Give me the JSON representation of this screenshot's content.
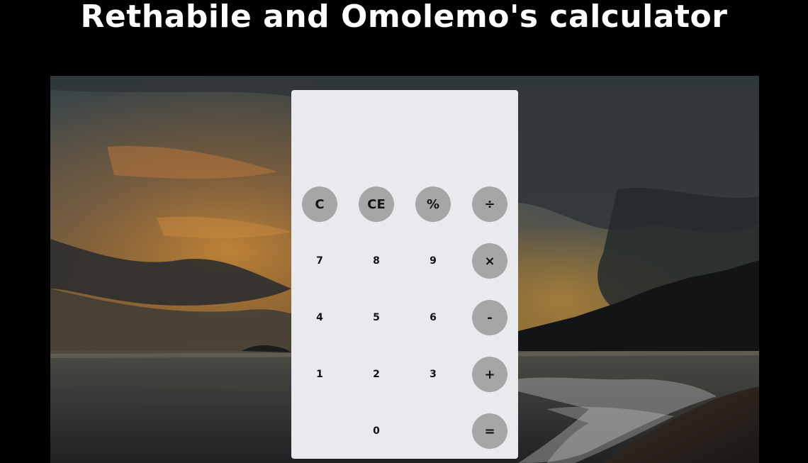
{
  "title": "Rethabile and Omolemo's calculator",
  "display": {
    "value": ""
  },
  "keys": {
    "clear": "C",
    "clear_entry": "CE",
    "percent": "%",
    "divide": "÷",
    "seven": "7",
    "eight": "8",
    "nine": "9",
    "multiply": "×",
    "four": "4",
    "five": "5",
    "six": "6",
    "minus": "-",
    "one": "1",
    "two": "2",
    "three": "3",
    "plus": "+",
    "zero": "0",
    "equals": "="
  },
  "colors": {
    "page_background": "#000000",
    "calculator_panel": "#e8eaed",
    "operator_key": "#a6a6a6",
    "title_text": "#ffffff"
  }
}
